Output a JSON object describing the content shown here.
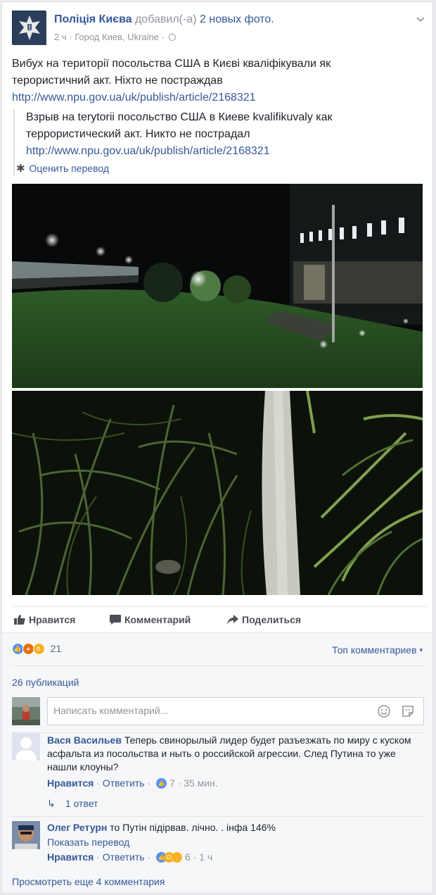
{
  "post": {
    "page_name": "Поліція Києва",
    "added_text": "добавил(-а)",
    "photos_link": "2 новых фото.",
    "time": "2 ч",
    "separator": "·",
    "location": "Город Киев, Ukraine",
    "text_line1": "Вибух на території посольства США в Києві кваліфікували як",
    "text_line2": "терористичний акт. Ніхто не постраждав",
    "link": "http://www.npu.gov.ua/uk/publish/article/2168321",
    "translation_line1": "Взрыв на terytorii посольство США в Киеве kvalifikuvaly как",
    "translation_line2": "террористический акт. Никто не пострадал",
    "translation_link": "http://www.npu.gov.ua/uk/publish/article/2168321",
    "rate_translation": "Оценить перевод"
  },
  "actions": {
    "like": "Нравится",
    "comment": "Комментарий",
    "share": "Поделиться"
  },
  "stats": {
    "reaction_count": "21",
    "top_comments": "Топ комментариев",
    "shares": "26 публикаций"
  },
  "comment_input": {
    "placeholder": "Написать комментарий..."
  },
  "comments": [
    {
      "author": "Вася Васильев",
      "text": "Теперь свинорылый лидер будет разъезжать по миру с куском асфальта из посольства и ныть о российской агрессии. След Путина то уже нашли клоуны?",
      "like_label": "Нравится",
      "reply_label": "Ответить",
      "reactions": "7",
      "time": "35 мин.",
      "replies": "1 ответ"
    },
    {
      "author": "Олег Ретурн",
      "text": "то Путін підірвав. лічно. . інфа 146%",
      "show_translation": "Показать перевод",
      "like_label": "Нравится",
      "reply_label": "Ответить",
      "reactions": "6",
      "time": "1 ч"
    }
  ],
  "more_comments": "Просмотреть еще 4 комментария",
  "colors": {
    "link": "#365899",
    "muted": "#90949c",
    "like_blue": "#5890ff",
    "angry_orange": "#e9710f",
    "wow_yellow": "#f7b125"
  }
}
